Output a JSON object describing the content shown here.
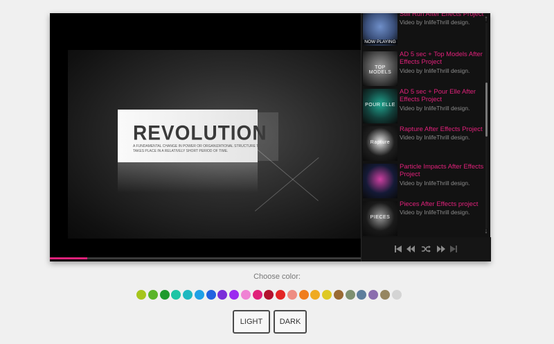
{
  "player": {
    "video": {
      "card_title": "REVOLUTION",
      "card_subtitle": "A FUNDAMENTAL CHANGE IN POWER OR ORGANIZATIONAL STRUCTURE THAT TAKES PLACE IN A RELATIVELY SHORT PERIOD OF TIME.",
      "progress_fraction": 0.12
    },
    "playlist": {
      "now_playing_label": "NOW PLAYING",
      "items": [
        {
          "title": "Still Run After Effects Project",
          "by": "Video by InlifeThrill design.",
          "thumb_text": "",
          "thumb_bg": "#3a4f7a",
          "accent": "#6f8fc9"
        },
        {
          "title": "AD 5 sec + Top Models After Effects Project",
          "by": "Video by InlifeThrill design.",
          "thumb_text": "TOP MODELS",
          "thumb_bg": "#4b4b4b",
          "accent": "#9c9c9c"
        },
        {
          "title": "AD 5 sec + Pour Elle After Effects Project",
          "by": "Video by InlifeThrill design.",
          "thumb_text": "POUR ELLE",
          "thumb_bg": "#123f3a",
          "accent": "#20a590"
        },
        {
          "title": "Rapture After Effects Project",
          "by": "Video by InlifeThrill design.",
          "thumb_text": "Rapture",
          "thumb_bg": "#1e1e1e",
          "accent": "#e8e8e8"
        },
        {
          "title": "Particle Impacts After Effects Project",
          "by": "Video by InlifeThrill design.",
          "thumb_text": "",
          "thumb_bg": "#141a36",
          "accent": "#cc3fa0"
        },
        {
          "title": "Pieces After Effects project",
          "by": "Video by InlifeThrill design.",
          "thumb_text": "PIECES",
          "thumb_bg": "#1a1a1a",
          "accent": "#9a9a9a"
        }
      ]
    },
    "controls": [
      "first-icon",
      "previous-icon",
      "shuffle-icon",
      "next-icon",
      "last-icon"
    ]
  },
  "theme": {
    "choose_label": "Choose color:",
    "colors": [
      "#a6c51c",
      "#5bb42a",
      "#1f9a2d",
      "#1dc5a6",
      "#1eb8c0",
      "#1fa0e6",
      "#2262e0",
      "#7b2ed9",
      "#9b2bf0",
      "#ef82d4",
      "#e0217a",
      "#b3122e",
      "#e32525",
      "#ee8c82",
      "#f07d1e",
      "#efaa21",
      "#dec924",
      "#9a6a33",
      "#7e9070",
      "#5d7e9c",
      "#8a6dae",
      "#968661",
      "#d4d4d4"
    ],
    "light_label": "LIGHT",
    "dark_label": "DARK"
  }
}
